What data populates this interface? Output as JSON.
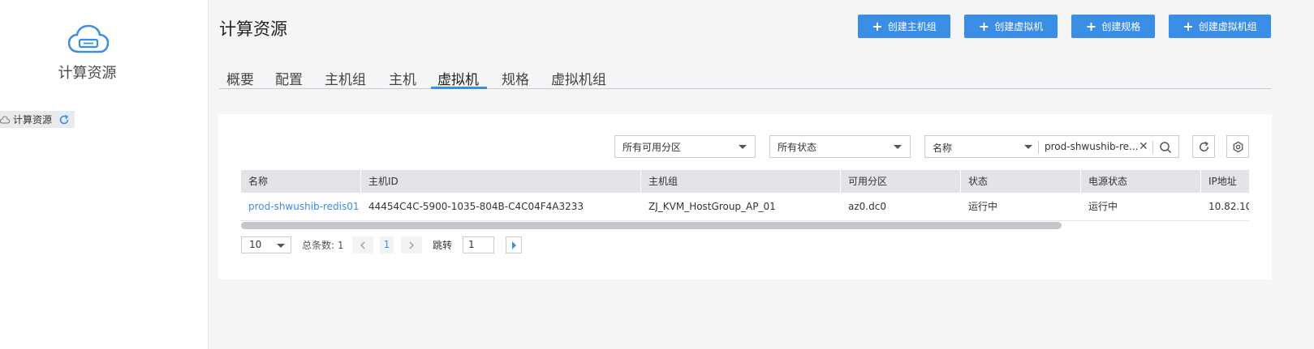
{
  "sidebar": {
    "title": "计算资源",
    "tree_label": "计算资源"
  },
  "header": {
    "title": "计算资源",
    "buttons": [
      "创建主机组",
      "创建虚拟机",
      "创建规格",
      "创建虚拟机组"
    ]
  },
  "tabs": [
    "概要",
    "配置",
    "主机组",
    "主机",
    "虚拟机",
    "规格",
    "虚拟机组"
  ],
  "active_tab": "虚拟机",
  "filters": {
    "zone": "所有可用分区",
    "status": "所有状态",
    "search_field": "名称",
    "search_value": "prod-shwushib-re..."
  },
  "table": {
    "headers": [
      "名称",
      "主机ID",
      "主机组",
      "可用分区",
      "状态",
      "电源状态",
      "IP地址"
    ],
    "rows": [
      [
        "prod-shwushib-redis01",
        "44454C4C-5900-1035-804B-C4C04F4A3233",
        "ZJ_KVM_HostGroup_AP_01",
        "az0.dc0",
        "运行中",
        "运行中",
        "10.82.10"
      ]
    ]
  },
  "pagination": {
    "page_size": "10",
    "total": "总条数: 1",
    "current_page": "1",
    "jump_label": "跳转",
    "jump_value": "1"
  },
  "colors": {
    "accent": "#3a8ee6",
    "header_bg": "#e2e4e7"
  },
  "icons": [
    "cloud-icon",
    "refresh-icon",
    "plus-icon",
    "caret-down-icon",
    "close-icon",
    "search-icon",
    "settings-icon",
    "chevron-left-icon",
    "chevron-right-icon",
    "play-icon"
  ]
}
